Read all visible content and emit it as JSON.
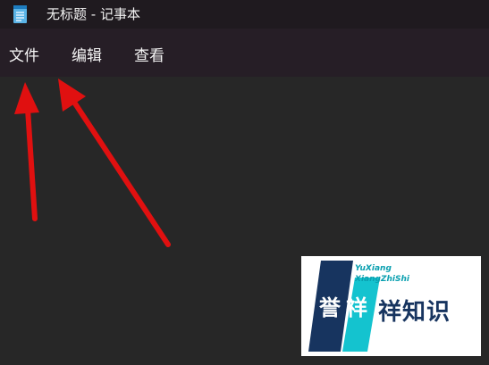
{
  "window": {
    "title": "无标题 - 记事本",
    "app_icon": "notepad-icon"
  },
  "menubar": {
    "items": [
      {
        "label": "文件"
      },
      {
        "label": "编辑"
      },
      {
        "label": "查看"
      }
    ]
  },
  "editor": {
    "content": ""
  },
  "annotations": {
    "arrows": [
      {
        "points_to": "file-menu",
        "color": "#e01010"
      },
      {
        "points_to": "edit-menu",
        "color": "#e01010"
      }
    ]
  },
  "watermark": {
    "line1": "YuXiang",
    "line2": "XiangZhiShi",
    "seal1": "誉",
    "seal2": "祥",
    "text": "祥知识",
    "colors": {
      "navy": "#17345f",
      "teal": "#14c3cf"
    }
  },
  "colors": {
    "titlebar": "#1f1a1f",
    "menubar": "#261e26",
    "editor": "#272727",
    "text": "#f5f5f5"
  }
}
